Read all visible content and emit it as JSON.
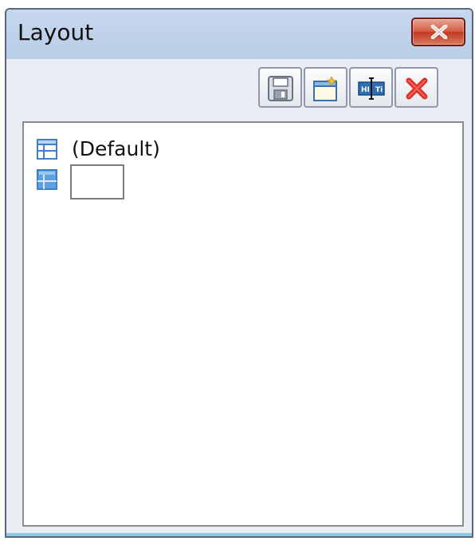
{
  "window": {
    "title": "Layout",
    "close_icon": "close-icon"
  },
  "toolbar": {
    "buttons": [
      {
        "name": "save-layout-button",
        "icon": "save-icon"
      },
      {
        "name": "new-layout-button",
        "icon": "new-layout-icon"
      },
      {
        "name": "rename-layout-button",
        "icon": "rename-icon"
      },
      {
        "name": "delete-layout-button",
        "icon": "delete-icon"
      }
    ]
  },
  "layouts": {
    "items": [
      {
        "label": "(Default)",
        "icon": "table-layout-icon"
      },
      {
        "value": "",
        "icon": "table-layout-selected-icon",
        "editing": true
      }
    ]
  },
  "colors": {
    "titlebar": "#c6d8ee",
    "window_bg": "#eaeef4",
    "close_red": "#c13a22",
    "delete_red": "#e0302a",
    "layout_icon_blue": "#3f7fc6"
  }
}
